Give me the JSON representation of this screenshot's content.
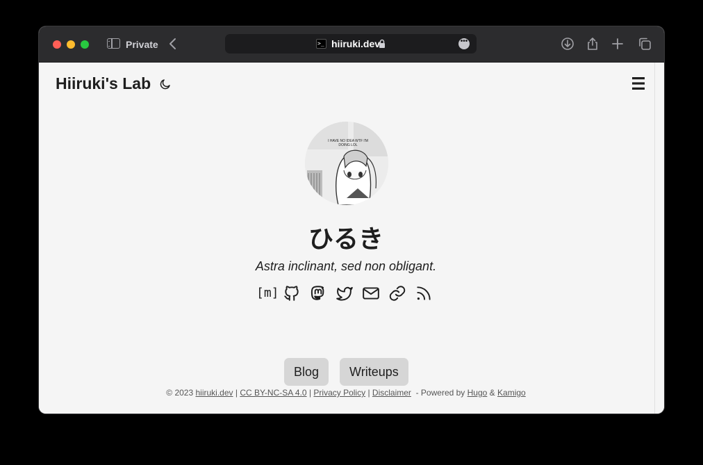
{
  "browser": {
    "private_label": "Private",
    "url": "hiiruki.dev",
    "more_glyph": "•••",
    "favicon_text": ">_"
  },
  "site": {
    "title": "Hiiruki's Lab",
    "name": "ひるき",
    "tagline": "Astra inclinant, sed non obligant.",
    "matrix_label": "[m]",
    "avatar_caption": "I HAVE NO IDEA WTF I'M DOING LOL",
    "buttons": [
      "Blog",
      "Writeups"
    ]
  },
  "footer": {
    "copyright": "© 2023",
    "links": [
      "hiiruki.dev",
      "CC BY-NC-SA 4.0",
      "Privacy Policy",
      "Disclaimer"
    ],
    "separator": "|",
    "powered_by": "- Powered by",
    "hugo": "Hugo",
    "amp": "&",
    "kamigo": "Kamigo"
  },
  "icons": [
    "sidebar-icon",
    "back-icon",
    "lock-icon",
    "more-icon",
    "download-icon",
    "share-icon",
    "new-tab-icon",
    "tabs-icon",
    "moon-icon",
    "menu-icon",
    "matrix-icon",
    "github-icon",
    "mastodon-icon",
    "twitter-icon",
    "mail-icon",
    "link-icon",
    "rss-icon"
  ]
}
